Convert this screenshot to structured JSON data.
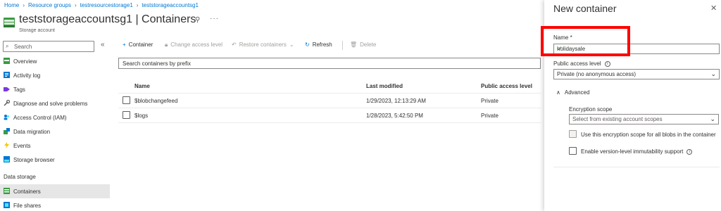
{
  "breadcrumb": [
    "Home",
    "Resource groups",
    "testresourcestorage1",
    "teststorageaccountsg1"
  ],
  "header": {
    "title": "teststorageaccountsg1 | Containers",
    "subtitle": "Storage account",
    "more": "···"
  },
  "sidebar": {
    "search_placeholder": "Search",
    "collapse": "«",
    "items": [
      {
        "label": "Overview",
        "icon": "overview-icon"
      },
      {
        "label": "Activity log",
        "icon": "activity-log-icon"
      },
      {
        "label": "Tags",
        "icon": "tag-icon"
      },
      {
        "label": "Diagnose and solve problems",
        "icon": "wrench-icon"
      },
      {
        "label": "Access Control (IAM)",
        "icon": "people-icon"
      },
      {
        "label": "Data migration",
        "icon": "migration-icon"
      },
      {
        "label": "Events",
        "icon": "lightning-icon"
      },
      {
        "label": "Storage browser",
        "icon": "storage-browser-icon"
      }
    ],
    "section_label": "Data storage",
    "section_items": [
      {
        "label": "Containers",
        "icon": "containers-icon",
        "active": true
      },
      {
        "label": "File shares",
        "icon": "file-shares-icon"
      }
    ]
  },
  "toolbar": {
    "container": "Container",
    "change_access": "Change access level",
    "restore": "Restore containers",
    "refresh": "Refresh",
    "delete": "Delete"
  },
  "container_search_placeholder": "Search containers by prefix",
  "table": {
    "headers": [
      "Name",
      "Last modified",
      "Public access level"
    ],
    "rows": [
      {
        "name": "$blobchangefeed",
        "modified": "1/29/2023, 12:13:29 AM",
        "access": "Private"
      },
      {
        "name": "$logs",
        "modified": "1/28/2023, 5:42:50 PM",
        "access": "Private"
      }
    ]
  },
  "panel": {
    "title": "New container",
    "close": "✕",
    "name_label": "Name *",
    "name_value": "holidaysale",
    "public_access_label": "Public access level",
    "public_access_value": "Private (no anonymous access)",
    "advanced_label": "Advanced",
    "encryption_label": "Encryption scope",
    "encryption_placeholder": "Select from existing account scopes",
    "encryption_checkbox": "Use this encryption scope for all blobs in the container",
    "immutability_checkbox": "Enable version-level immutability support"
  },
  "colors": {
    "accent": "#0078d4",
    "highlight": "#ff0000",
    "valid": "#107c10"
  }
}
